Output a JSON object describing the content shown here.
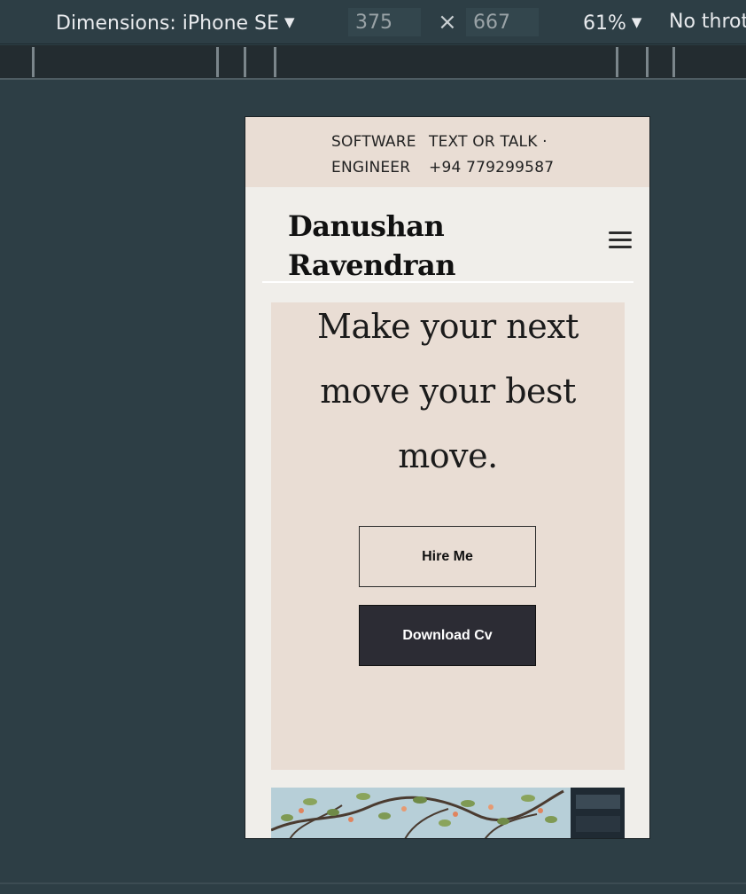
{
  "devtools": {
    "device_label": "Dimensions: iPhone SE",
    "width": "375",
    "height": "667",
    "times": "×",
    "zoom": "61%",
    "throttle": "No throt"
  },
  "site": {
    "topbar": {
      "col1": [
        "SOFTWARE",
        "ENGINEER"
      ],
      "col2": [
        "TEXT OR TALK ·",
        "+94 779299587"
      ]
    },
    "brand": [
      "Danushan",
      "Ravendran"
    ],
    "hero": {
      "title_lines": [
        "Make your next",
        "move your best",
        "move."
      ],
      "hire_label": "Hire Me",
      "cv_label": "Download Cv"
    },
    "colors": {
      "beige": "#e9ddd4",
      "page_bg": "#f0eeea",
      "dark_button": "#2c2c34"
    }
  }
}
